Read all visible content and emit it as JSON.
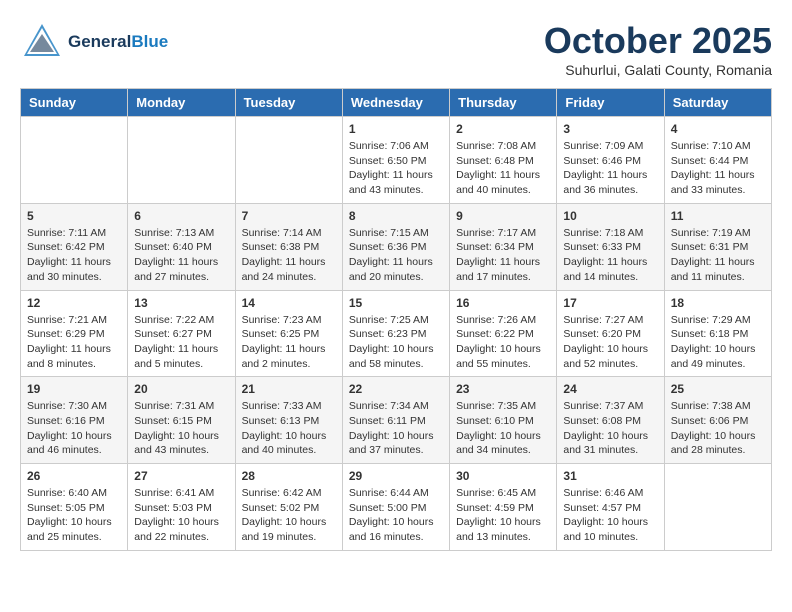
{
  "logo": {
    "general": "General",
    "blue": "Blue"
  },
  "title": "October 2025",
  "subtitle": "Suhurlui, Galati County, Romania",
  "headers": [
    "Sunday",
    "Monday",
    "Tuesday",
    "Wednesday",
    "Thursday",
    "Friday",
    "Saturday"
  ],
  "weeks": [
    [
      {
        "day": "",
        "info": ""
      },
      {
        "day": "",
        "info": ""
      },
      {
        "day": "",
        "info": ""
      },
      {
        "day": "1",
        "info": "Sunrise: 7:06 AM\nSunset: 6:50 PM\nDaylight: 11 hours and 43 minutes."
      },
      {
        "day": "2",
        "info": "Sunrise: 7:08 AM\nSunset: 6:48 PM\nDaylight: 11 hours and 40 minutes."
      },
      {
        "day": "3",
        "info": "Sunrise: 7:09 AM\nSunset: 6:46 PM\nDaylight: 11 hours and 36 minutes."
      },
      {
        "day": "4",
        "info": "Sunrise: 7:10 AM\nSunset: 6:44 PM\nDaylight: 11 hours and 33 minutes."
      }
    ],
    [
      {
        "day": "5",
        "info": "Sunrise: 7:11 AM\nSunset: 6:42 PM\nDaylight: 11 hours and 30 minutes."
      },
      {
        "day": "6",
        "info": "Sunrise: 7:13 AM\nSunset: 6:40 PM\nDaylight: 11 hours and 27 minutes."
      },
      {
        "day": "7",
        "info": "Sunrise: 7:14 AM\nSunset: 6:38 PM\nDaylight: 11 hours and 24 minutes."
      },
      {
        "day": "8",
        "info": "Sunrise: 7:15 AM\nSunset: 6:36 PM\nDaylight: 11 hours and 20 minutes."
      },
      {
        "day": "9",
        "info": "Sunrise: 7:17 AM\nSunset: 6:34 PM\nDaylight: 11 hours and 17 minutes."
      },
      {
        "day": "10",
        "info": "Sunrise: 7:18 AM\nSunset: 6:33 PM\nDaylight: 11 hours and 14 minutes."
      },
      {
        "day": "11",
        "info": "Sunrise: 7:19 AM\nSunset: 6:31 PM\nDaylight: 11 hours and 11 minutes."
      }
    ],
    [
      {
        "day": "12",
        "info": "Sunrise: 7:21 AM\nSunset: 6:29 PM\nDaylight: 11 hours and 8 minutes."
      },
      {
        "day": "13",
        "info": "Sunrise: 7:22 AM\nSunset: 6:27 PM\nDaylight: 11 hours and 5 minutes."
      },
      {
        "day": "14",
        "info": "Sunrise: 7:23 AM\nSunset: 6:25 PM\nDaylight: 11 hours and 2 minutes."
      },
      {
        "day": "15",
        "info": "Sunrise: 7:25 AM\nSunset: 6:23 PM\nDaylight: 10 hours and 58 minutes."
      },
      {
        "day": "16",
        "info": "Sunrise: 7:26 AM\nSunset: 6:22 PM\nDaylight: 10 hours and 55 minutes."
      },
      {
        "day": "17",
        "info": "Sunrise: 7:27 AM\nSunset: 6:20 PM\nDaylight: 10 hours and 52 minutes."
      },
      {
        "day": "18",
        "info": "Sunrise: 7:29 AM\nSunset: 6:18 PM\nDaylight: 10 hours and 49 minutes."
      }
    ],
    [
      {
        "day": "19",
        "info": "Sunrise: 7:30 AM\nSunset: 6:16 PM\nDaylight: 10 hours and 46 minutes."
      },
      {
        "day": "20",
        "info": "Sunrise: 7:31 AM\nSunset: 6:15 PM\nDaylight: 10 hours and 43 minutes."
      },
      {
        "day": "21",
        "info": "Sunrise: 7:33 AM\nSunset: 6:13 PM\nDaylight: 10 hours and 40 minutes."
      },
      {
        "day": "22",
        "info": "Sunrise: 7:34 AM\nSunset: 6:11 PM\nDaylight: 10 hours and 37 minutes."
      },
      {
        "day": "23",
        "info": "Sunrise: 7:35 AM\nSunset: 6:10 PM\nDaylight: 10 hours and 34 minutes."
      },
      {
        "day": "24",
        "info": "Sunrise: 7:37 AM\nSunset: 6:08 PM\nDaylight: 10 hours and 31 minutes."
      },
      {
        "day": "25",
        "info": "Sunrise: 7:38 AM\nSunset: 6:06 PM\nDaylight: 10 hours and 28 minutes."
      }
    ],
    [
      {
        "day": "26",
        "info": "Sunrise: 6:40 AM\nSunset: 5:05 PM\nDaylight: 10 hours and 25 minutes."
      },
      {
        "day": "27",
        "info": "Sunrise: 6:41 AM\nSunset: 5:03 PM\nDaylight: 10 hours and 22 minutes."
      },
      {
        "day": "28",
        "info": "Sunrise: 6:42 AM\nSunset: 5:02 PM\nDaylight: 10 hours and 19 minutes."
      },
      {
        "day": "29",
        "info": "Sunrise: 6:44 AM\nSunset: 5:00 PM\nDaylight: 10 hours and 16 minutes."
      },
      {
        "day": "30",
        "info": "Sunrise: 6:45 AM\nSunset: 4:59 PM\nDaylight: 10 hours and 13 minutes."
      },
      {
        "day": "31",
        "info": "Sunrise: 6:46 AM\nSunset: 4:57 PM\nDaylight: 10 hours and 10 minutes."
      },
      {
        "day": "",
        "info": ""
      }
    ]
  ]
}
